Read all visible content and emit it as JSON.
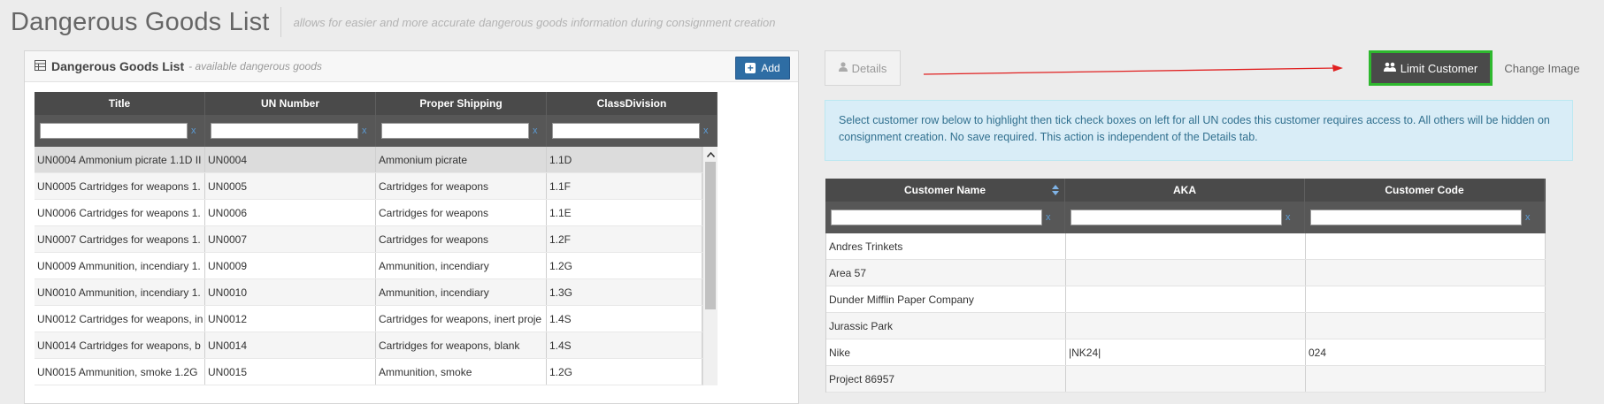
{
  "header": {
    "title": "Dangerous Goods List",
    "subtitle": "allows for easier and more accurate dangerous goods information during consignment creation"
  },
  "dg_panel": {
    "title": "Dangerous Goods List",
    "subtitle": "- available dangerous goods",
    "add_label": "Add",
    "columns": [
      "Title",
      "UN Number",
      "Proper Shipping",
      "ClassDivision"
    ],
    "filter_clear": "x",
    "rows": [
      {
        "title": "UN0004 Ammonium picrate 1.1D II",
        "un": "UN0004",
        "shipping": "Ammonium picrate",
        "class": "1.1D"
      },
      {
        "title": "UN0005 Cartridges for weapons 1.",
        "un": "UN0005",
        "shipping": "Cartridges for weapons",
        "class": "1.1F"
      },
      {
        "title": "UN0006 Cartridges for weapons 1.",
        "un": "UN0006",
        "shipping": "Cartridges for weapons",
        "class": "1.1E"
      },
      {
        "title": "UN0007 Cartridges for weapons 1.",
        "un": "UN0007",
        "shipping": "Cartridges for weapons",
        "class": "1.2F"
      },
      {
        "title": "UN0009 Ammunition, incendiary 1.",
        "un": "UN0009",
        "shipping": "Ammunition, incendiary",
        "class": "1.2G"
      },
      {
        "title": "UN0010 Ammunition, incendiary 1.",
        "un": "UN0010",
        "shipping": "Ammunition, incendiary",
        "class": "1.3G"
      },
      {
        "title": "UN0012 Cartridges for weapons, in",
        "un": "UN0012",
        "shipping": "Cartridges for weapons, inert proje",
        "class": "1.4S"
      },
      {
        "title": "UN0014 Cartridges for weapons, b",
        "un": "UN0014",
        "shipping": "Cartridges for weapons, blank",
        "class": "1.4S"
      },
      {
        "title": "UN0015 Ammunition, smoke 1.2G",
        "un": "UN0015",
        "shipping": "Ammunition, smoke",
        "class": "1.2G"
      }
    ]
  },
  "tabs": {
    "details": "Details",
    "limit_customer": "Limit Customer",
    "change_image": "Change Image"
  },
  "info": {
    "text": "Select customer row below to highlight then tick check boxes on left for all UN codes this customer requires access to. All others will be hidden on consignment creation. No save required. This action is independent of the Details tab."
  },
  "customers": {
    "columns": [
      "Customer Name",
      "AKA",
      "Customer Code"
    ],
    "filter_clear": "x",
    "rows": [
      {
        "name": "Andres Trinkets",
        "aka": "",
        "code": ""
      },
      {
        "name": "Area 57",
        "aka": "",
        "code": ""
      },
      {
        "name": "Dunder Mifflin Paper Company",
        "aka": "",
        "code": ""
      },
      {
        "name": "Jurassic Park",
        "aka": "",
        "code": ""
      },
      {
        "name": "Nike",
        "aka": "|NK24|",
        "code": "024"
      },
      {
        "name": "Project 86957",
        "aka": "",
        "code": ""
      }
    ]
  },
  "colors": {
    "accent": "#2e6da4",
    "active_tab_border": "#2eb82e",
    "arrow": "#e02020",
    "info_bg": "#d9edf7"
  }
}
